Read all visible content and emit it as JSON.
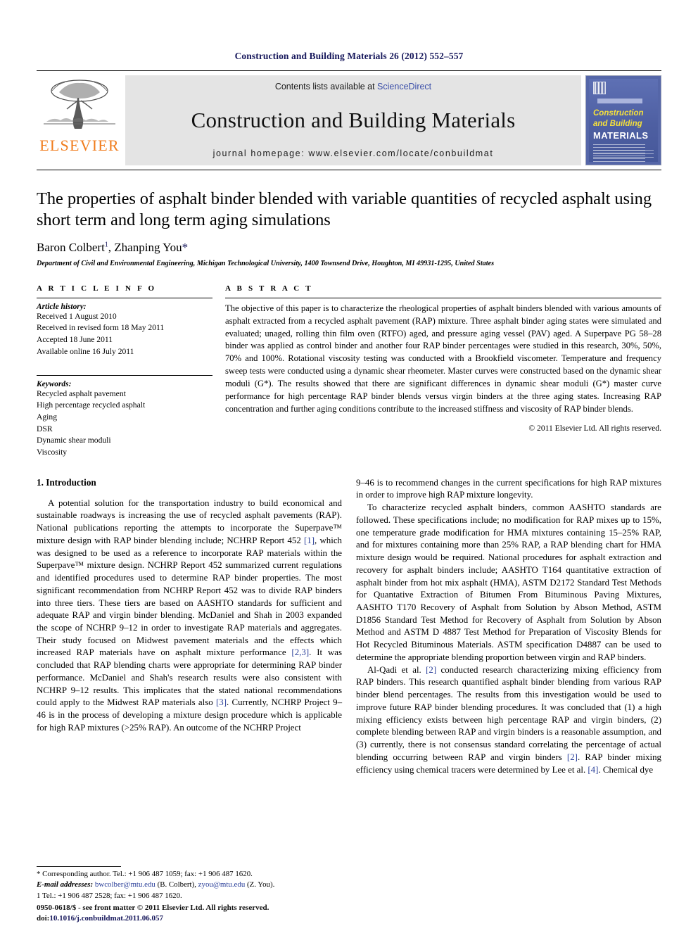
{
  "running_head": "Construction and Building Materials 26 (2012) 552–557",
  "masthead": {
    "publisher": "ELSEVIER",
    "contents_prefix": "Contents lists available at ",
    "sciencedirect": "ScienceDirect",
    "journal_title": "Construction and Building Materials",
    "homepage": "journal homepage: www.elsevier.com/locate/conbuildmat",
    "cover": {
      "line1": "Construction",
      "line2": "and Building",
      "line3": "MATERIALS"
    }
  },
  "article": {
    "title": "The properties of asphalt binder blended with variable quantities of recycled asphalt using short term and long term aging simulations",
    "authors_pre": "Baron Colbert",
    "authors_sup": "1",
    "authors_mid": ", Zhanping You",
    "authors_star": "*",
    "affiliation": "Department of Civil and Environmental Engineering, Michigan Technological University, 1400 Townsend Drive, Houghton, MI 49931-1295, United States"
  },
  "info": {
    "heading": "A R T I C L E   I N F O",
    "history_label": "Article history:",
    "history": [
      "Received 1 August 2010",
      "Received in revised form 18 May 2011",
      "Accepted 18 June 2011",
      "Available online 16 July 2011"
    ],
    "keywords_label": "Keywords:",
    "keywords": [
      "Recycled asphalt pavement",
      "High percentage recycled asphalt",
      "Aging",
      "DSR",
      "Dynamic shear moduli",
      "Viscosity"
    ]
  },
  "abstract": {
    "heading": "A B S T R A C T",
    "text": "The objective of this paper is to characterize the rheological properties of asphalt binders blended with various amounts of asphalt extracted from a recycled asphalt pavement (RAP) mixture. Three asphalt binder aging states were simulated and evaluated; unaged, rolling thin film oven (RTFO) aged, and pressure aging vessel (PAV) aged. A Superpave PG 58–28 binder was applied as control binder and another four RAP binder percentages were studied in this research, 30%, 50%, 70% and 100%. Rotational viscosity testing was conducted with a Brookfield viscometer. Temperature and frequency sweep tests were conducted using a dynamic shear rheometer. Master curves were constructed based on the dynamic shear moduli (G*). The results showed that there are significant differences in dynamic shear moduli (G*) master curve performance for high percentage RAP binder blends versus virgin binders at the three aging states. Increasing RAP concentration and further aging conditions contribute to the increased stiffness and viscosity of RAP binder blends.",
    "copyright": "© 2011 Elsevier Ltd. All rights reserved."
  },
  "body": {
    "section_title": "1. Introduction",
    "left_para_1_a": "A potential solution for the transportation industry to build economical and sustainable roadways is increasing the use of recycled asphalt pavements (RAP). National publications reporting the attempts to incorporate the Superpave™ mixture design with RAP binder blending include; NCHRP Report 452 ",
    "cite_1": "[1]",
    "left_para_1_b": ", which was designed to be used as a reference to incorporate RAP materials within the Superpave™ mixture design. NCHRP Report 452 summarized current regulations and identified procedures used to determine RAP binder properties. The most significant recommendation from NCHRP Report 452 was to divide RAP binders into three tiers. These tiers are based on AASHTO standards for sufficient and adequate RAP and virgin binder blending. McDaniel and Shah in 2003 expanded the scope of NCHRP 9–12 in order to investigate RAP materials and aggregates. Their study focused on Midwest pavement materials and the effects which increased RAP materials have on asphalt mixture performance ",
    "cite_23": "[2,3]",
    "left_para_1_c": ". It was concluded that RAP blending charts were appropriate for determining RAP binder performance. McDaniel and Shah's research results were also consistent with NCHRP 9–12 results. This implicates that the stated national recommendations could apply to the Midwest RAP materials also ",
    "cite_3": "[3]",
    "left_para_1_d": ". Currently, NCHRP Project 9–46 is in the process of developing a mixture design procedure which is applicable for high RAP mixtures (>25% RAP). An outcome of the NCHRP Project",
    "right_para_cont": "9–46 is to recommend changes in the current specifications for high RAP mixtures in order to improve high RAP mixture longevity.",
    "right_para_2": "To characterize recycled asphalt binders, common AASHTO standards are followed. These specifications include; no modification for RAP mixes up to 15%, one temperature grade modification for HMA mixtures containing 15–25% RAP, and for mixtures containing more than 25% RAP, a RAP blending chart for HMA mixture design would be required. National procedures for asphalt extraction and recovery for asphalt binders include; AASHTO T164 quantitative extraction of asphalt binder from hot mix asphalt (HMA), ASTM D2172 Standard Test Methods for Quantative Extraction of Bitumen From Bituminous Paving Mixtures, AASHTO T170 Recovery of Asphalt from Solution by Abson Method, ASTM D1856 Standard Test Method for Recovery of Asphalt from Solution by Abson Method and ASTM D 4887 Test Method for Preparation of Viscosity Blends for Hot Recycled Bituminous Materials. ASTM specification D4887 can be used to determine the appropriate blending proportion between virgin and RAP binders.",
    "right_para_3_a": "Al-Qadi et al. ",
    "cite_2": "[2]",
    "right_para_3_b": " conducted research characterizing mixing efficiency from RAP binders. This research quantified asphalt binder blending from various RAP binder blend percentages. The results from this investigation would be used to improve future RAP binder blending procedures. It was concluded that (1) a high mixing efficiency exists between high percentage RAP and virgin binders, (2) complete blending between RAP and virgin binders is a reasonable assumption, and (3) currently, there is not consensus standard correlating the percentage of actual blending occurring between RAP and virgin binders ",
    "cite_2b": "[2]",
    "right_para_3_c": ". RAP binder mixing efficiency using chemical tracers were determined by Lee et al. ",
    "cite_4": "[4]",
    "right_para_3_d": ". Chemical dye"
  },
  "footnotes": {
    "corresponding": "* Corresponding author. Tel.: +1 906 487 1059; fax: +1 906 487 1620.",
    "email_label": "E-mail addresses:",
    "email_1": "bwcolber@mtu.edu",
    "email_1_name": " (B. Colbert), ",
    "email_2": "zyou@mtu.edu",
    "email_2_name": " (Z. You).",
    "note_1": "1 Tel.: +1 906 487 2528; fax: +1 906 487 1620."
  },
  "imprint": {
    "line1": "0950-0618/$ - see front matter © 2011 Elsevier Ltd. All rights reserved.",
    "doi_label": "doi:",
    "doi": "10.1016/j.conbuildmat.2011.06.057"
  }
}
